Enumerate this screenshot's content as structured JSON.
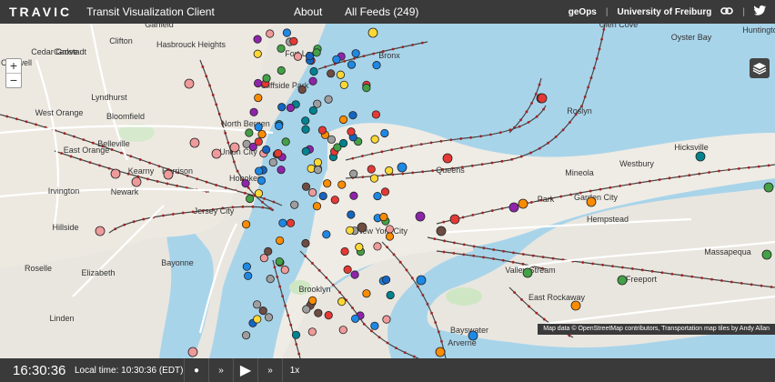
{
  "header": {
    "logo": "TRAVIC",
    "subtitle": "Transit Visualization Client",
    "about": "About",
    "feeds": "All Feeds (249)",
    "geops": "geOps",
    "sep": "|",
    "university": "University of Freiburg"
  },
  "map": {
    "zoom_in": "+",
    "zoom_out": "−",
    "attribution": "Map data © OpenStreetMap contributors, Transportation map tiles by Andy Allan",
    "places": [
      "Garfield",
      "Hasbrouck Heights",
      "Clifton",
      "Carlstadt",
      "Caldwell",
      "Cedar Grove",
      "Fort Lee",
      "Bronx",
      "Cliffside Park",
      "Glen Cove",
      "Oyster Bay",
      "Huntington",
      "West Orange",
      "Lyndhurst",
      "Belleville",
      "Bloomfield",
      "North Bergen",
      "Union City",
      "Roslyn",
      "Kearny",
      "East Orange",
      "Harrison",
      "Hoboken",
      "Queens",
      "Mineola",
      "Westbury",
      "Hicksville",
      "Newark",
      "Irvington",
      "Garden City",
      "Park",
      "Jersey City",
      "Hempstead",
      "Hillside",
      "New York City",
      "Massapequa",
      "Bayonne",
      "Roselle",
      "Elizabeth",
      "Valley Stream",
      "Freeport",
      "East Rockaway",
      "Brooklyn",
      "Linden",
      "Bayswater",
      "Arverne"
    ]
  },
  "footer": {
    "clock": "16:30:36",
    "local_time": "Local time: 10:30:36 (EDT)",
    "record": "●",
    "rewind": "»",
    "play": "▶",
    "forward": "»",
    "speed": "1x"
  }
}
